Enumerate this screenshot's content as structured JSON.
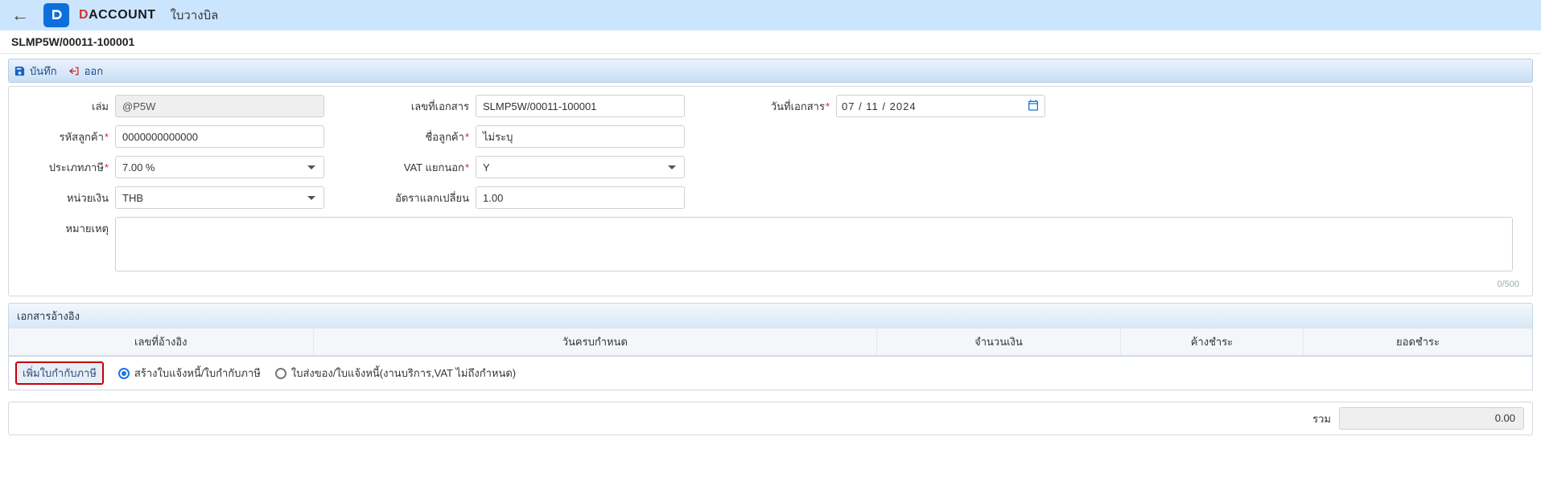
{
  "topbar": {
    "brand_left": "D",
    "brand_right": "ACCOUNT",
    "title": "ใบวางบิล"
  },
  "subtitle": "SLMP5W/00011-100001",
  "toolbar": {
    "save": "บันทึก",
    "exit": "ออก"
  },
  "form": {
    "labels": {
      "book": "เล่ม",
      "docno": "เลขที่เอกสาร",
      "docdate": "วันที่เอกสาร",
      "custcode": "รหัสลูกค้า",
      "custname": "ชื่อลูกค้า",
      "taxtype": "ประเภทภาษี",
      "vatout": "VAT แยกนอก",
      "currency": "หน่วยเงิน",
      "rate": "อัตราแลกเปลี่ยน",
      "remark": "หมายเหตุ"
    },
    "values": {
      "book": "@P5W",
      "docno": "SLMP5W/00011-100001",
      "docdate": "07 / 11 / 2024",
      "custcode": "0000000000000",
      "custname": "ไม่ระบุ",
      "taxtype": "7.00 %",
      "vatout": "Y",
      "currency": "THB",
      "rate": "1.00",
      "remark": ""
    },
    "counter": "0/500"
  },
  "section_ref": "เอกสารอ้างอิง",
  "table": {
    "headers": {
      "refno": "เลขที่อ้างอิง",
      "duedate": "วันครบกำหนด",
      "amount": "จำนวนเงิน",
      "outstanding": "ค้างชำระ",
      "pay": "ยอดชำระ"
    }
  },
  "action": {
    "button": "เพิ่มใบกำกับภาษี",
    "radio1": "สร้างใบแจ้งหนี้/ใบกำกับภาษี",
    "radio2": "ใบส่งของ/ใบแจ้งหนี้(งานบริการ,VAT ไม่ถึงกำหนด)"
  },
  "total": {
    "label": "รวม",
    "value": "0.00"
  },
  "colors": {
    "accent": "#cce5ff",
    "primary": "#1a73e8"
  }
}
